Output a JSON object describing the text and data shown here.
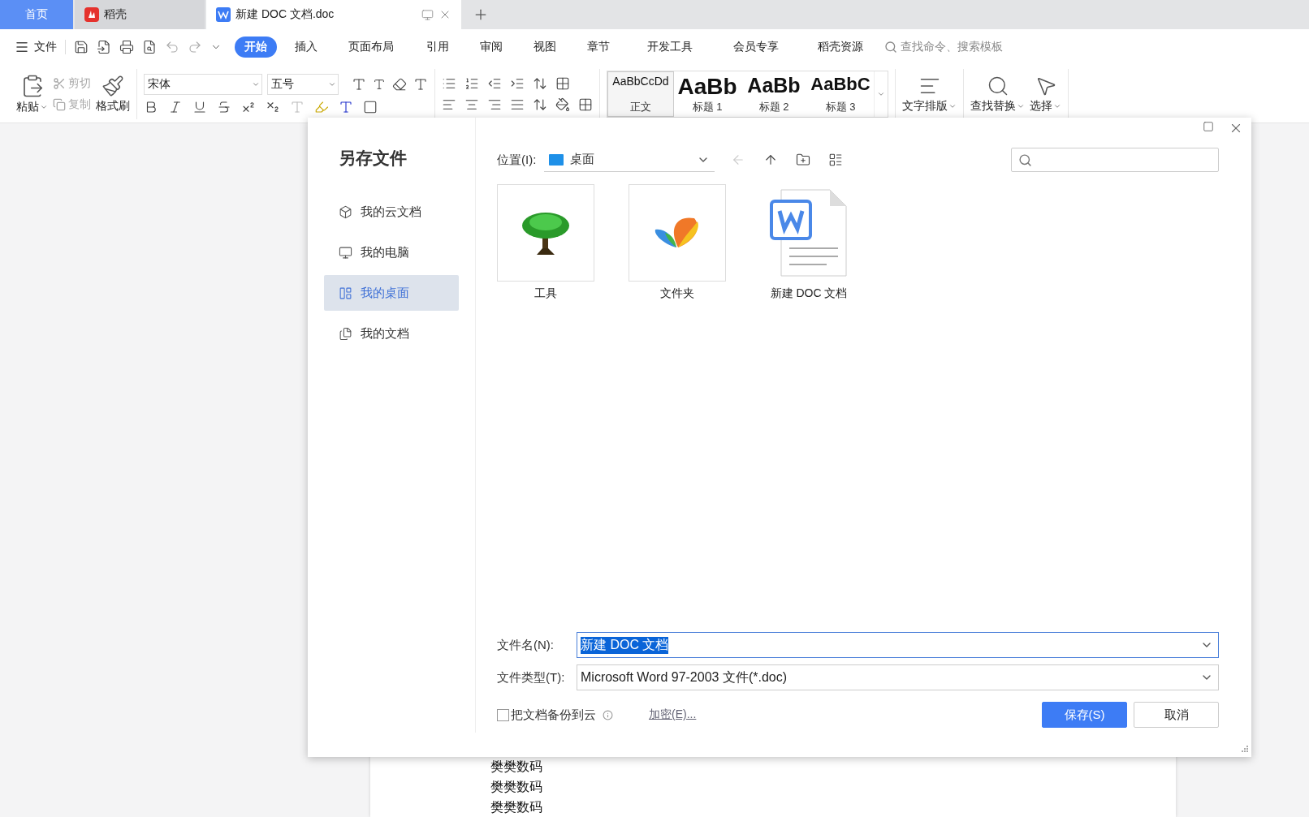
{
  "tabs": [
    {
      "label": "首页",
      "kind": "home",
      "selected": false
    },
    {
      "label": "稻壳",
      "kind": "docer",
      "selected": false
    },
    {
      "label": "新建 DOC 文档.doc",
      "kind": "doc",
      "selected": true
    }
  ],
  "menu": {
    "file": "文件",
    "tabs": [
      {
        "label": "开始",
        "selected": true
      },
      {
        "label": "插入",
        "selected": false
      },
      {
        "label": "页面布局",
        "selected": false
      },
      {
        "label": "引用",
        "selected": false
      },
      {
        "label": "审阅",
        "selected": false
      },
      {
        "label": "视图",
        "selected": false
      },
      {
        "label": "章节",
        "selected": false
      },
      {
        "label": "开发工具",
        "selected": false
      },
      {
        "label": "会员专享",
        "selected": false
      },
      {
        "label": "稻壳资源",
        "selected": false
      }
    ],
    "search": {
      "placeholder": "查找命令、搜索模板"
    }
  },
  "ribbon": {
    "paste": "粘贴",
    "cut": "剪切",
    "copy": "复制",
    "format_painter": "格式刷",
    "font_name": "宋体",
    "font_size": "五号",
    "styles": [
      {
        "preview": "AaBbCcDd",
        "label": "正文",
        "kind": "body",
        "selected": true
      },
      {
        "preview": "AaBb",
        "label": "标题 1",
        "kind": "h1",
        "selected": false
      },
      {
        "preview": "AaBb",
        "label": "标题 2",
        "kind": "h2",
        "selected": false
      },
      {
        "preview": "AaBbC",
        "label": "标题 3",
        "kind": "h3",
        "selected": false
      }
    ],
    "text_layout": "文字排版",
    "find_replace": "查找替换",
    "select": "选择"
  },
  "document": {
    "lines": [
      "樊樊数码",
      "樊樊数码",
      "樊樊数码"
    ]
  },
  "dialog": {
    "title": "另存文件",
    "sidebar": [
      {
        "label": "我的云文档",
        "kind": "cloud",
        "selected": false
      },
      {
        "label": "我的电脑",
        "kind": "pc",
        "selected": false
      },
      {
        "label": "我的桌面",
        "kind": "desktop",
        "selected": true
      },
      {
        "label": "我的文档",
        "kind": "docs",
        "selected": false
      }
    ],
    "location": {
      "label": "位置(I):",
      "value": "桌面"
    },
    "files": [
      {
        "name": "工具",
        "kind": "tree"
      },
      {
        "name": "文件夹",
        "kind": "butterfly"
      },
      {
        "name": "新建 DOC 文档",
        "kind": "doc"
      }
    ],
    "filename": {
      "label": "文件名(N):",
      "value": "新建 DOC 文档"
    },
    "filetype": {
      "label": "文件类型(T):",
      "value": "Microsoft Word 97-2003 文件(*.doc)"
    },
    "backup": {
      "label": "把文档备份到云",
      "checked": false
    },
    "encrypt": "加密(E)...",
    "save": "保存(S)",
    "cancel": "取消"
  }
}
